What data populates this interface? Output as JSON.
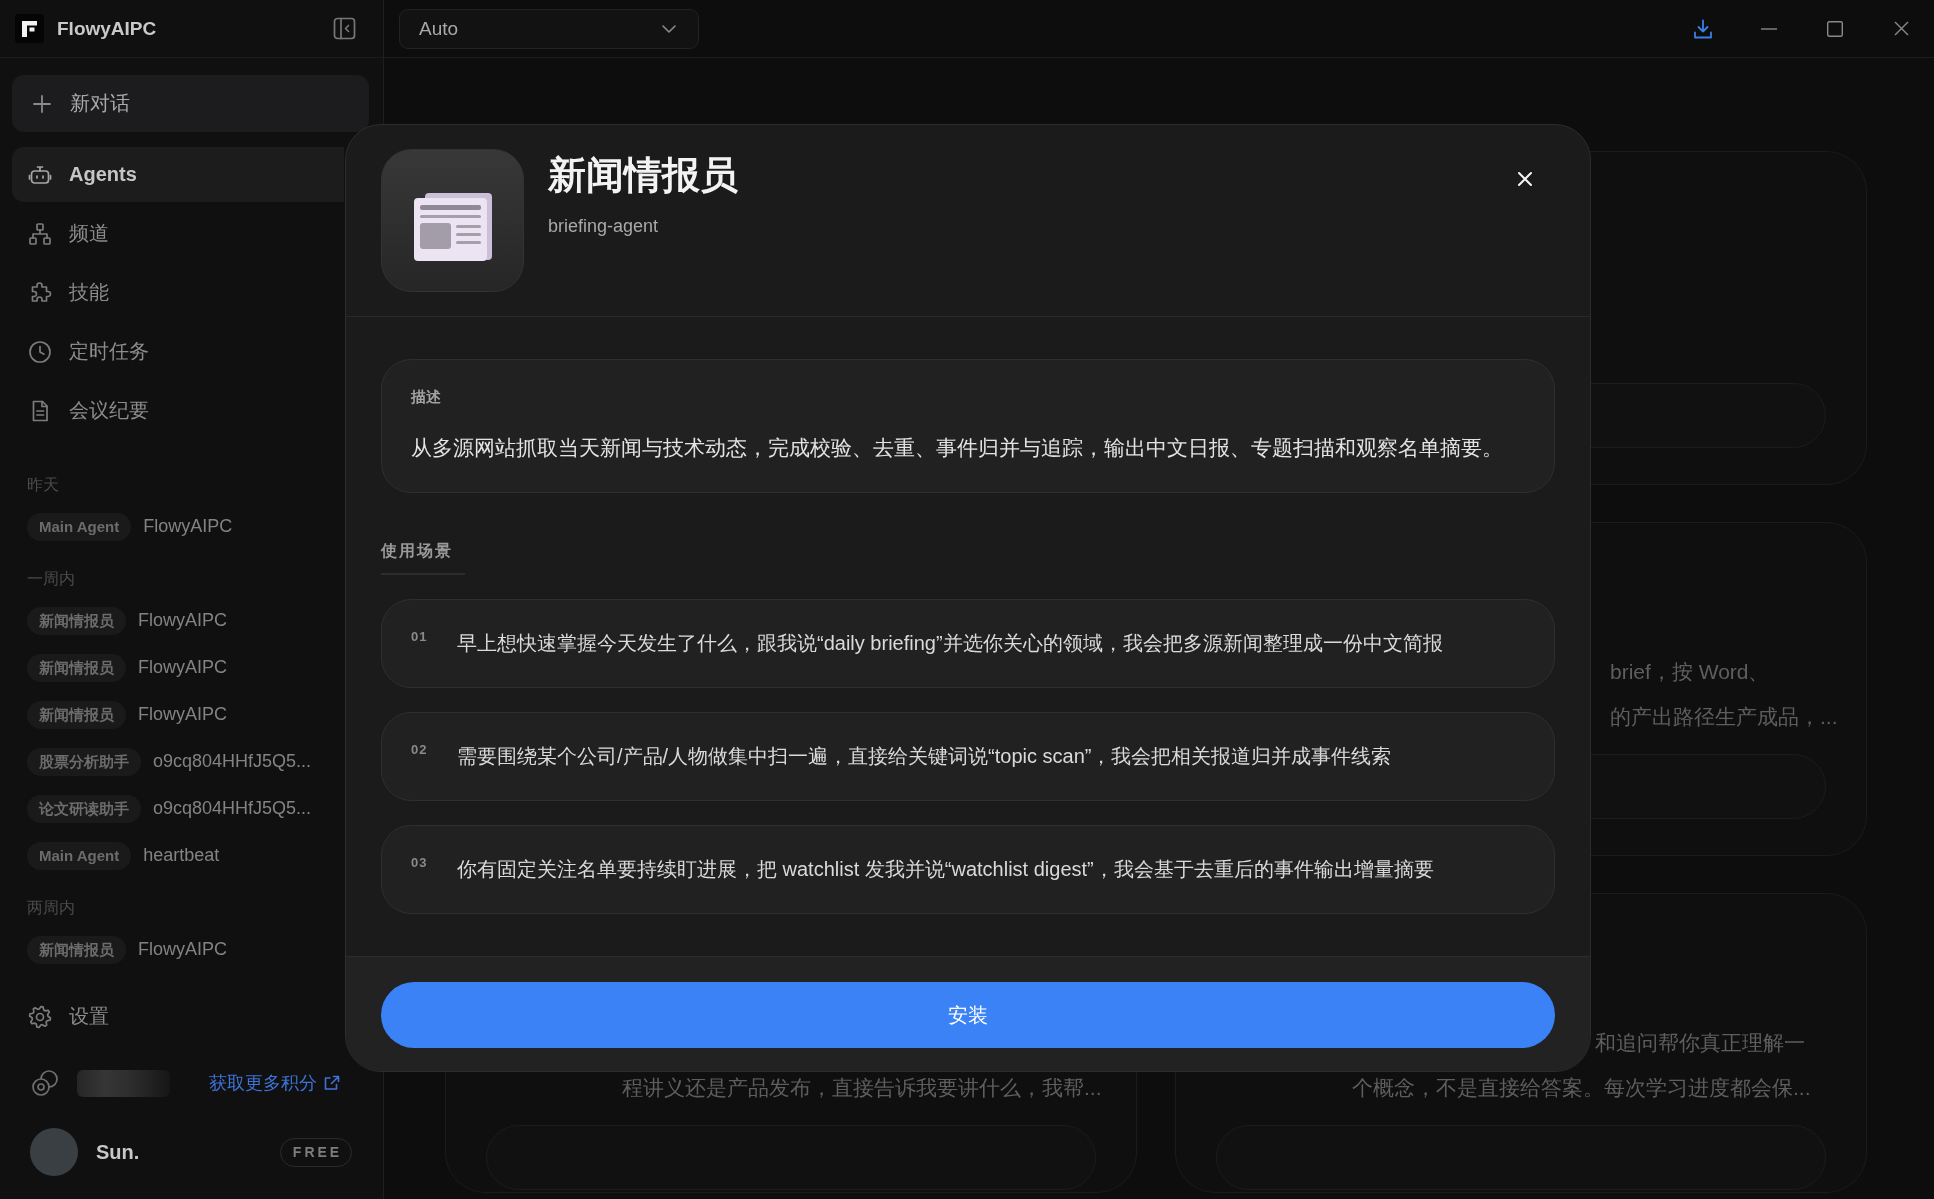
{
  "sidebar": {
    "app_name": "FlowyAIPC",
    "new_chat": "新对话",
    "nav": [
      {
        "label": "Agents",
        "selected": true
      },
      {
        "label": "频道",
        "selected": false
      },
      {
        "label": "技能",
        "selected": false
      },
      {
        "label": "定时任务",
        "selected": false
      },
      {
        "label": "会议纪要",
        "selected": false
      }
    ],
    "history": [
      {
        "heading": "昨天",
        "items": [
          {
            "agent": "Main Agent",
            "title": "FlowyAIPC"
          }
        ]
      },
      {
        "heading": "一周内",
        "items": [
          {
            "agent": "新闻情报员",
            "title": "FlowyAIPC"
          },
          {
            "agent": "新闻情报员",
            "title": "FlowyAIPC"
          },
          {
            "agent": "新闻情报员",
            "title": "FlowyAIPC"
          },
          {
            "agent": "股票分析助手",
            "title": "o9cq804HHfJ5Q5..."
          },
          {
            "agent": "论文研读助手",
            "title": "o9cq804HHfJ5Q5..."
          },
          {
            "agent": "Main Agent",
            "title": "heartbeat"
          }
        ]
      },
      {
        "heading": "两周内",
        "items": [
          {
            "agent": "新闻情报员",
            "title": "FlowyAIPC"
          }
        ]
      }
    ],
    "settings": "设置",
    "credits_link": "获取更多积分",
    "user": {
      "name": "Sun.",
      "plan": "FREE"
    }
  },
  "toolbar": {
    "model_select": "Auto"
  },
  "background": {
    "columns": [
      {
        "cards": [
          {
            "lines": [
              "程讲义还是产品发布，直接告诉我要讲什么，我帮..."
            ]
          }
        ]
      },
      {
        "cards": [
          {
            "lines": [
              "brief，按 Word、",
              "的产出路径生产成品，..."
            ]
          },
          {
            "lines": [
              "和追问帮你真正理解一",
              "个概念，不是直接给答案。每次学习进度都会保..."
            ]
          }
        ]
      }
    ]
  },
  "dialog": {
    "title": "新闻情报员",
    "subtitle": "briefing-agent",
    "description_label": "描述",
    "description": "从多源网站抓取当天新闻与技术动态，完成校验、去重、事件归并与追踪，输出中文日报、专题扫描和观察名单摘要。",
    "scenarios_label": "使用场景",
    "scenarios": [
      {
        "number": "01",
        "text": "早上想快速掌握今天发生了什么，跟我说“daily briefing”并选你关心的领域，我会把多源新闻整理成一份中文简报"
      },
      {
        "number": "02",
        "text": "需要围绕某个公司/产品/人物做集中扫一遍，直接给关键词说“topic scan”，我会把相关报道归并成事件线索"
      },
      {
        "number": "03",
        "text": "你有固定关注名单要持续盯进展，把 watchlist 发我并说“watchlist digest”，我会基于去重后的事件输出增量摘要"
      }
    ],
    "install_button": "安装"
  }
}
